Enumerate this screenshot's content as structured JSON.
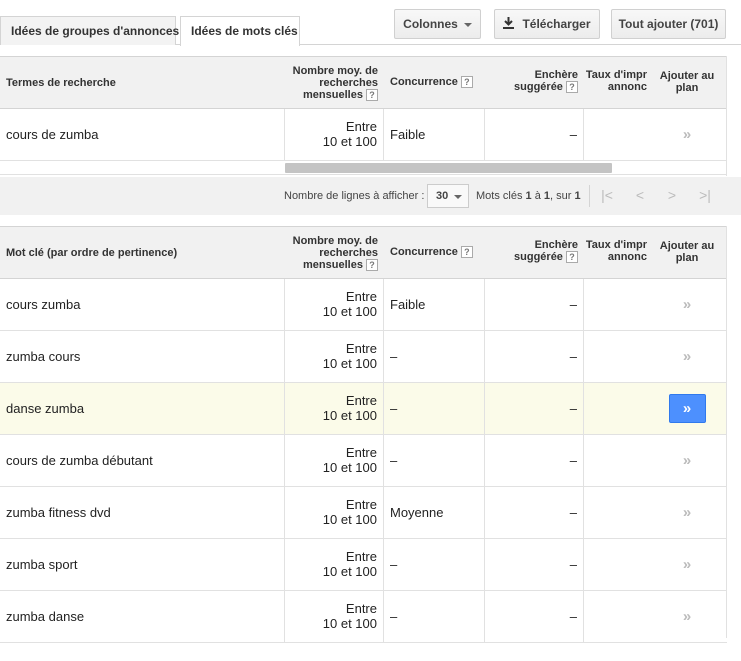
{
  "tabs": [
    {
      "label": "Idées de groupes d'annonces",
      "active": false
    },
    {
      "label": "Idées de mots clés",
      "active": true
    }
  ],
  "toolbar": {
    "columns_label": "Colonnes",
    "download_label": "Télécharger",
    "add_all_label": "Tout ajouter (701)"
  },
  "columns": {
    "search_terms": "Termes de recherche",
    "keyword": "Mot clé (par ordre de pertinence)",
    "volume_line1": "Nombre moy. de",
    "volume_line2": "recherches",
    "volume_line3": "mensuelles",
    "competition": "Concurrence",
    "bid_line1": "Enchère",
    "bid_line2": "suggérée",
    "impr_line1": "Taux d'impr",
    "impr_line2": "annonc",
    "add_line1": "Ajouter au",
    "add_line2": "plan",
    "help": "?"
  },
  "search_terms_rows": [
    {
      "keyword": "cours de zumba",
      "volume_line1": "Entre",
      "volume_line2": "10 et 100",
      "competition": "Faible",
      "bid": "–"
    }
  ],
  "pagination": {
    "rows_label": "Nombre de lignes à afficher :",
    "rows_value": "30",
    "range_prefix": "Mots clés ",
    "range_from": "1",
    "range_mid": " à ",
    "range_to": "1",
    "range_sep": ", sur ",
    "range_total": "1"
  },
  "keyword_rows": [
    {
      "keyword": "cours zumba",
      "volume_line1": "Entre",
      "volume_line2": "10 et 100",
      "competition": "Faible",
      "bid": "–",
      "highlighted": false
    },
    {
      "keyword": "zumba cours",
      "volume_line1": "Entre",
      "volume_line2": "10 et 100",
      "competition": "–",
      "bid": "–",
      "highlighted": false
    },
    {
      "keyword": "danse zumba",
      "volume_line1": "Entre",
      "volume_line2": "10 et 100",
      "competition": "–",
      "bid": "–",
      "highlighted": true
    },
    {
      "keyword": "cours de zumba débutant",
      "volume_line1": "Entre",
      "volume_line2": "10 et 100",
      "competition": "–",
      "bid": "–",
      "highlighted": false
    },
    {
      "keyword": "zumba fitness dvd",
      "volume_line1": "Entre",
      "volume_line2": "10 et 100",
      "competition": "Moyenne",
      "bid": "–",
      "highlighted": false
    },
    {
      "keyword": "zumba sport",
      "volume_line1": "Entre",
      "volume_line2": "10 et 100",
      "competition": "–",
      "bid": "–",
      "highlighted": false
    },
    {
      "keyword": "zumba danse",
      "volume_line1": "Entre",
      "volume_line2": "10 et 100",
      "competition": "–",
      "bid": "–",
      "highlighted": false
    }
  ],
  "icons": {
    "add": "»",
    "download": "download-icon",
    "first": "|<",
    "prev": "<",
    "next": ">",
    "last": ">|"
  }
}
